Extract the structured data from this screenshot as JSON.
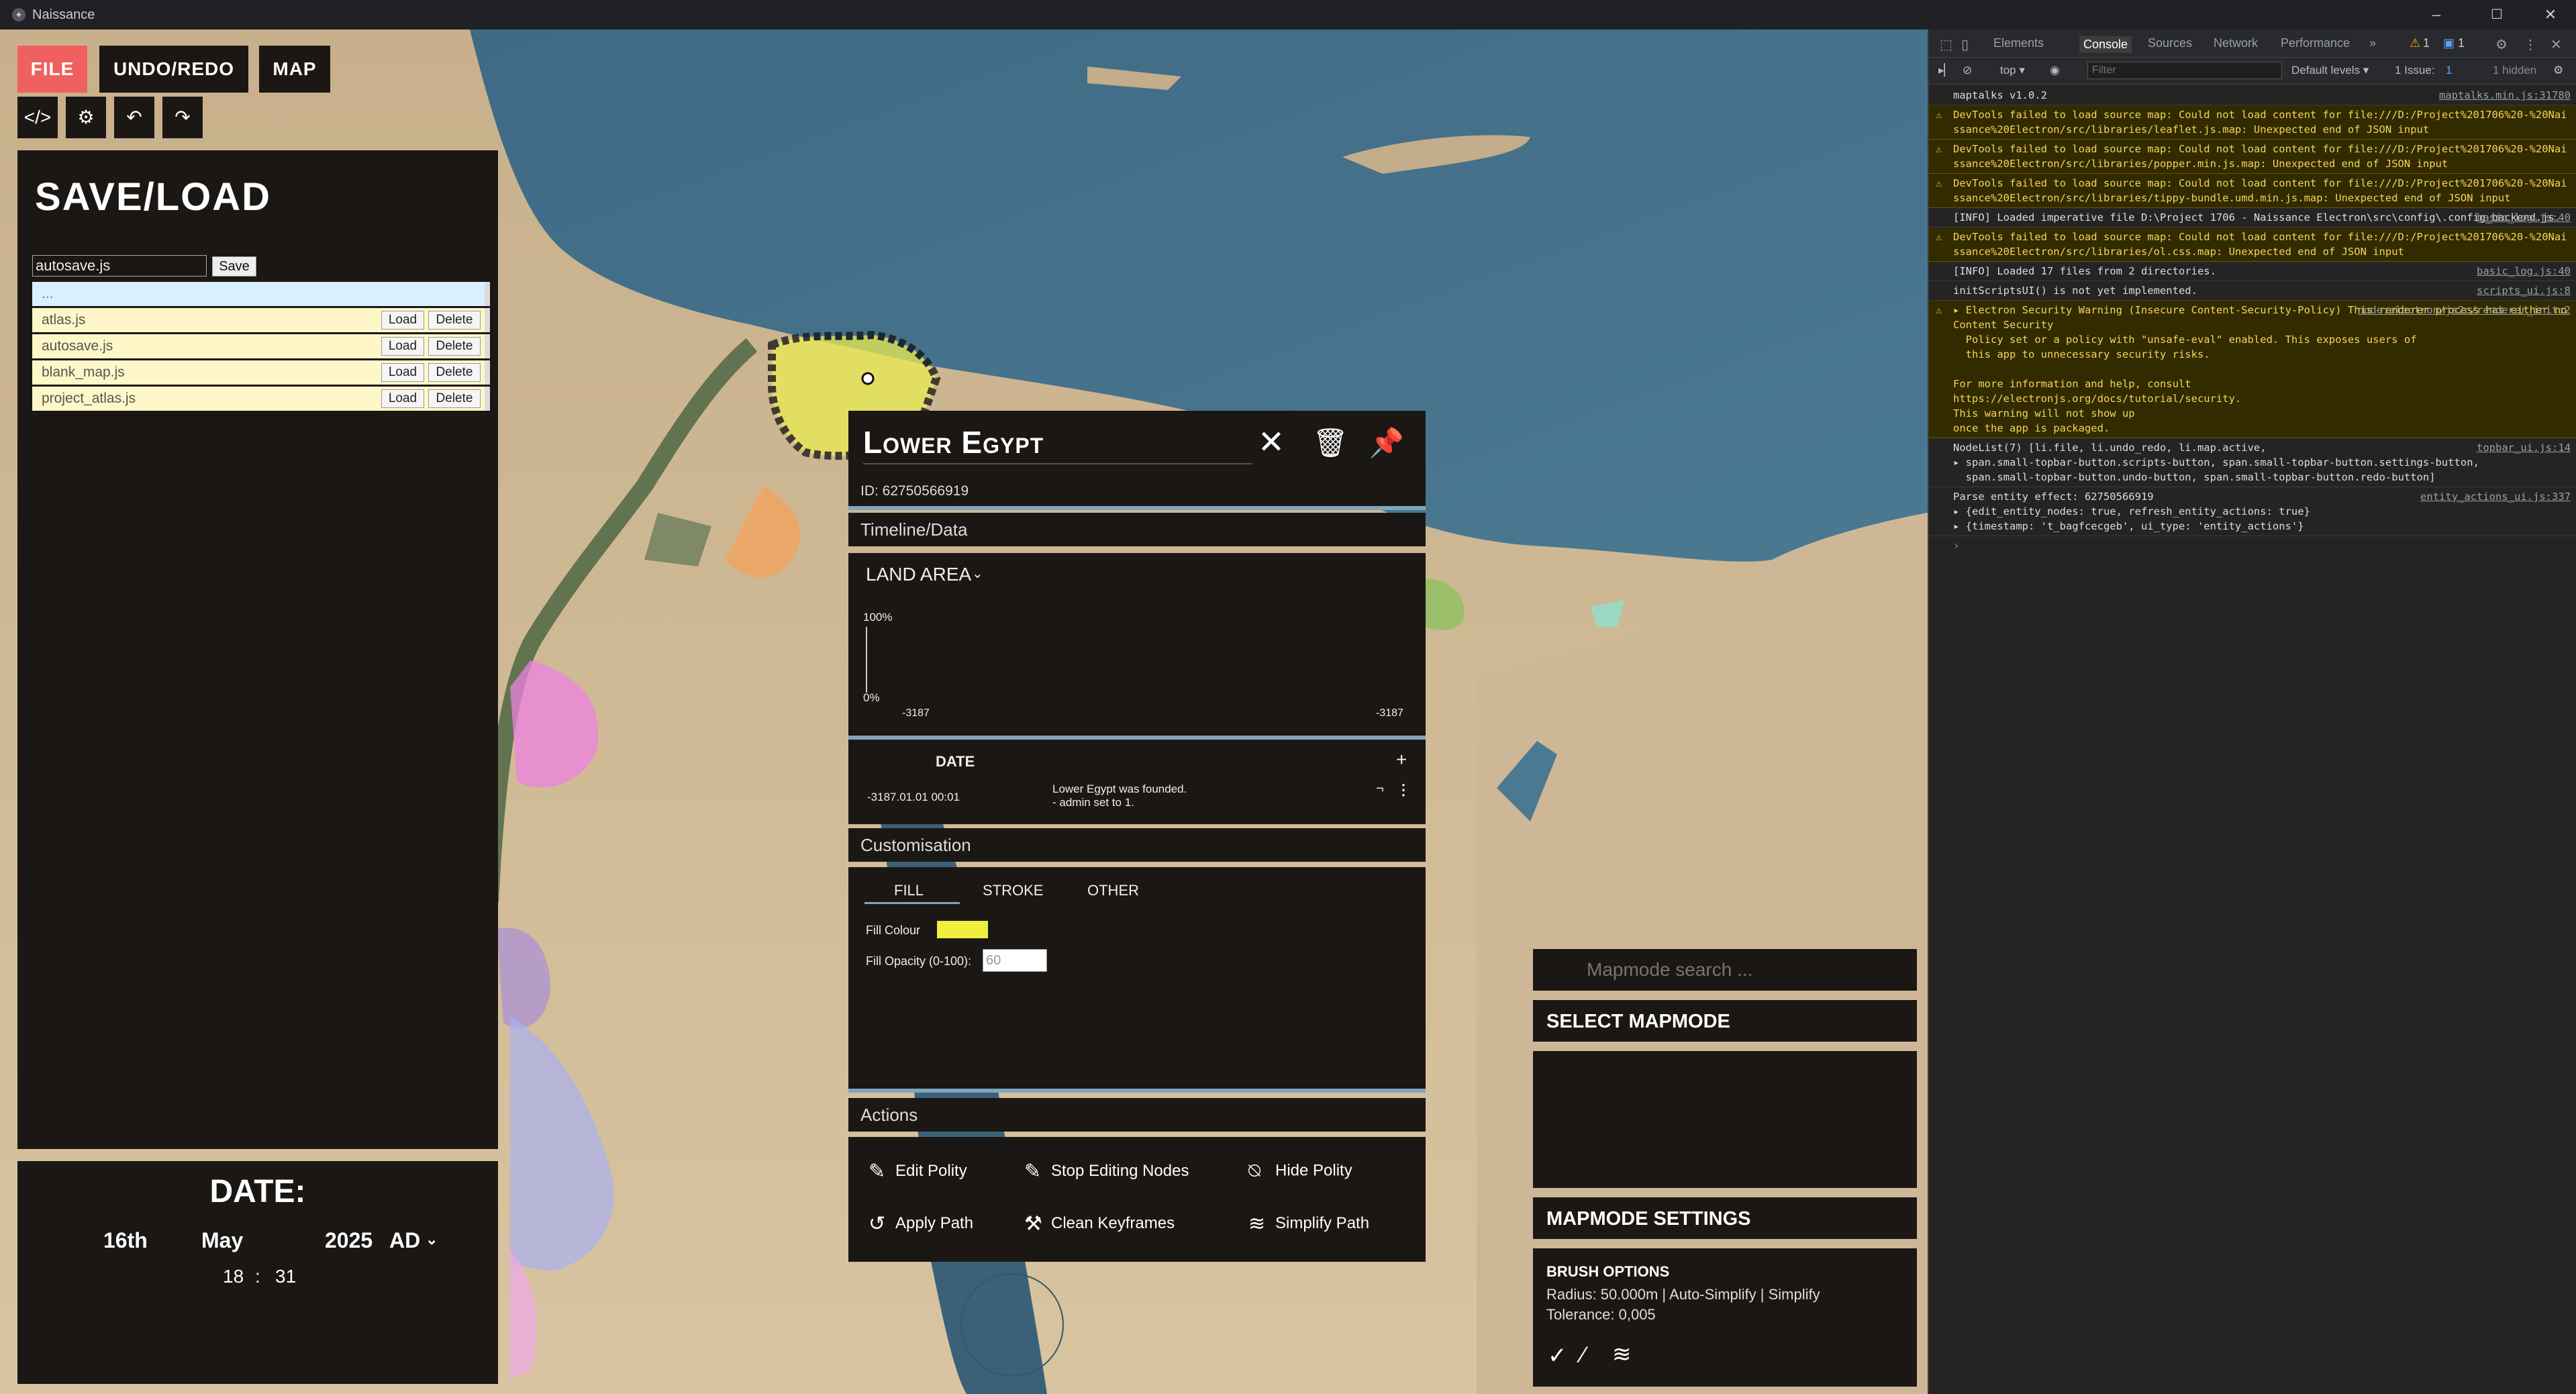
{
  "window": {
    "title": "Naissance",
    "minimize": "–",
    "maximize": "☐",
    "close": "✕"
  },
  "topbar": {
    "file": "FILE",
    "undo_redo": "UNDO/REDO",
    "map": "MAP",
    "small": [
      "</>",
      "⚙",
      "↶",
      "↷"
    ]
  },
  "save_load": {
    "title": "SAVE/LOAD",
    "filename_value": "autosave.js",
    "save_label": "Save",
    "parent_dir": "...",
    "load_label": "Load",
    "delete_label": "Delete",
    "files": [
      "atlas.js",
      "autosave.js",
      "blank_map.js",
      "project_atlas.js"
    ]
  },
  "date_panel": {
    "title": "DATE:",
    "day": "16th",
    "month": "May",
    "year": "2025",
    "era": "AD",
    "hour": "18",
    "separator": ":",
    "minute": "31"
  },
  "entity": {
    "name": "Lower Egypt",
    "id_text": "ID: 62750566919",
    "timeline_header": "Timeline/Data",
    "land_area_label": "LAND AREA",
    "chart_max": "100%",
    "chart_min": "0%",
    "chart_x_start": "-3187",
    "chart_x_end": "-3187",
    "date_header": "DATE",
    "date_add": "+",
    "history_date": "-3187.01.01 00:01",
    "history_text_1": "Lower Egypt was founded.",
    "history_text_2": "- admin set to 1.",
    "customisation_header": "Customisation",
    "tabs": [
      "FILL",
      "STROKE",
      "OTHER"
    ],
    "fill_colour_label": "Fill Colour",
    "fill_colour": "#f0ef3c",
    "fill_opacity_label": "Fill Opacity (0-100):",
    "fill_opacity_value": "60",
    "actions_header": "Actions",
    "actions": [
      "Edit Polity",
      "Stop Editing Nodes",
      "Hide Polity",
      "Apply Path",
      "Clean Keyframes",
      "Simplify Path"
    ]
  },
  "mapmode": {
    "search_placeholder": "Mapmode search ...",
    "select_title": "SELECT MAPMODE",
    "settings_title": "MAPMODE SETTINGS",
    "brush_title": "BRUSH OPTIONS",
    "brush_line1": "Radius: 50.000m | Auto-Simplify | Simplify",
    "brush_line2": "Tolerance: 0,005"
  },
  "devtools": {
    "tabs": [
      "Elements",
      "Console",
      "Sources",
      "Network",
      "Performance",
      "»"
    ],
    "warn_count": "1",
    "info_count": "1",
    "context": "top ▾",
    "filter_placeholder": "Filter",
    "levels": "Default levels ▾",
    "issues": "1 Issue: ",
    "issues_count": "1",
    "hidden": "1 hidden",
    "console": [
      {
        "type": "log",
        "text": "maptalks v1.0.2",
        "src": "maptalks.min.js:31780"
      },
      {
        "type": "warn",
        "text": "DevTools failed to load source map: Could not load content for file:///D:/Project%201706%20-%20Naissance%20Electron/src/libraries/leaflet.js.map: Unexpected end of JSON input",
        "src": ""
      },
      {
        "type": "warn",
        "text": "DevTools failed to load source map: Could not load content for file:///D:/Project%201706%20-%20Naissance%20Electron/src/libraries/popper.min.js.map: Unexpected end of JSON input",
        "src": ""
      },
      {
        "type": "warn",
        "text": "DevTools failed to load source map: Could not load content for file:///D:/Project%201706%20-%20Naissance%20Electron/src/libraries/tippy-bundle.umd.min.js.map: Unexpected end of JSON input",
        "src": ""
      },
      {
        "type": "log",
        "text": "[INFO] Loaded imperative file D:\\Project 1706 - Naissance Electron\\src\\config\\.config_backend.js.",
        "src": "basic_log.js:40"
      },
      {
        "type": "warn",
        "text": "DevTools failed to load source map: Could not load content for file:///D:/Project%201706%20-%20Naissance%20Electron/src/libraries/ol.css.map: Unexpected end of JSON input",
        "src": ""
      },
      {
        "type": "log",
        "text": "[INFO] Loaded 17 files from 2 directories.",
        "src": "basic_log.js:40"
      },
      {
        "type": "log",
        "text": "initScriptsUI() is not yet implemented.",
        "src": "scripts_ui.js:8"
      },
      {
        "type": "warn",
        "text": "▸ Electron Security Warning (Insecure Content-Security-Policy) This renderer process has either no Content Security\n  Policy set or a policy with \"unsafe-eval\" enabled. This exposes users of\n  this app to unnecessary security risks.\n\nFor more information and help, consult\nhttps://electronjs.org/docs/tutorial/security.\nThis warning will not show up\nonce the app is packaged.",
        "src": "node:electron/js2c/renderer_init:2"
      },
      {
        "type": "log",
        "text": "NodeList(7) [li.file, li.undo_redo, li.map.active,\n▸ span.small-topbar-button.scripts-button, span.small-topbar-button.settings-button,\n  span.small-topbar-button.undo-button, span.small-topbar-button.redo-button]",
        "src": "topbar_ui.js:14"
      },
      {
        "type": "log",
        "text": "Parse entity effect: 62750566919\n▸ {edit_entity_nodes: true, refresh_entity_actions: true}\n▸ {timestamp: 't_bagfcecgeb', ui_type: 'entity_actions'}",
        "src": "entity_actions_ui.js:337"
      }
    ]
  }
}
